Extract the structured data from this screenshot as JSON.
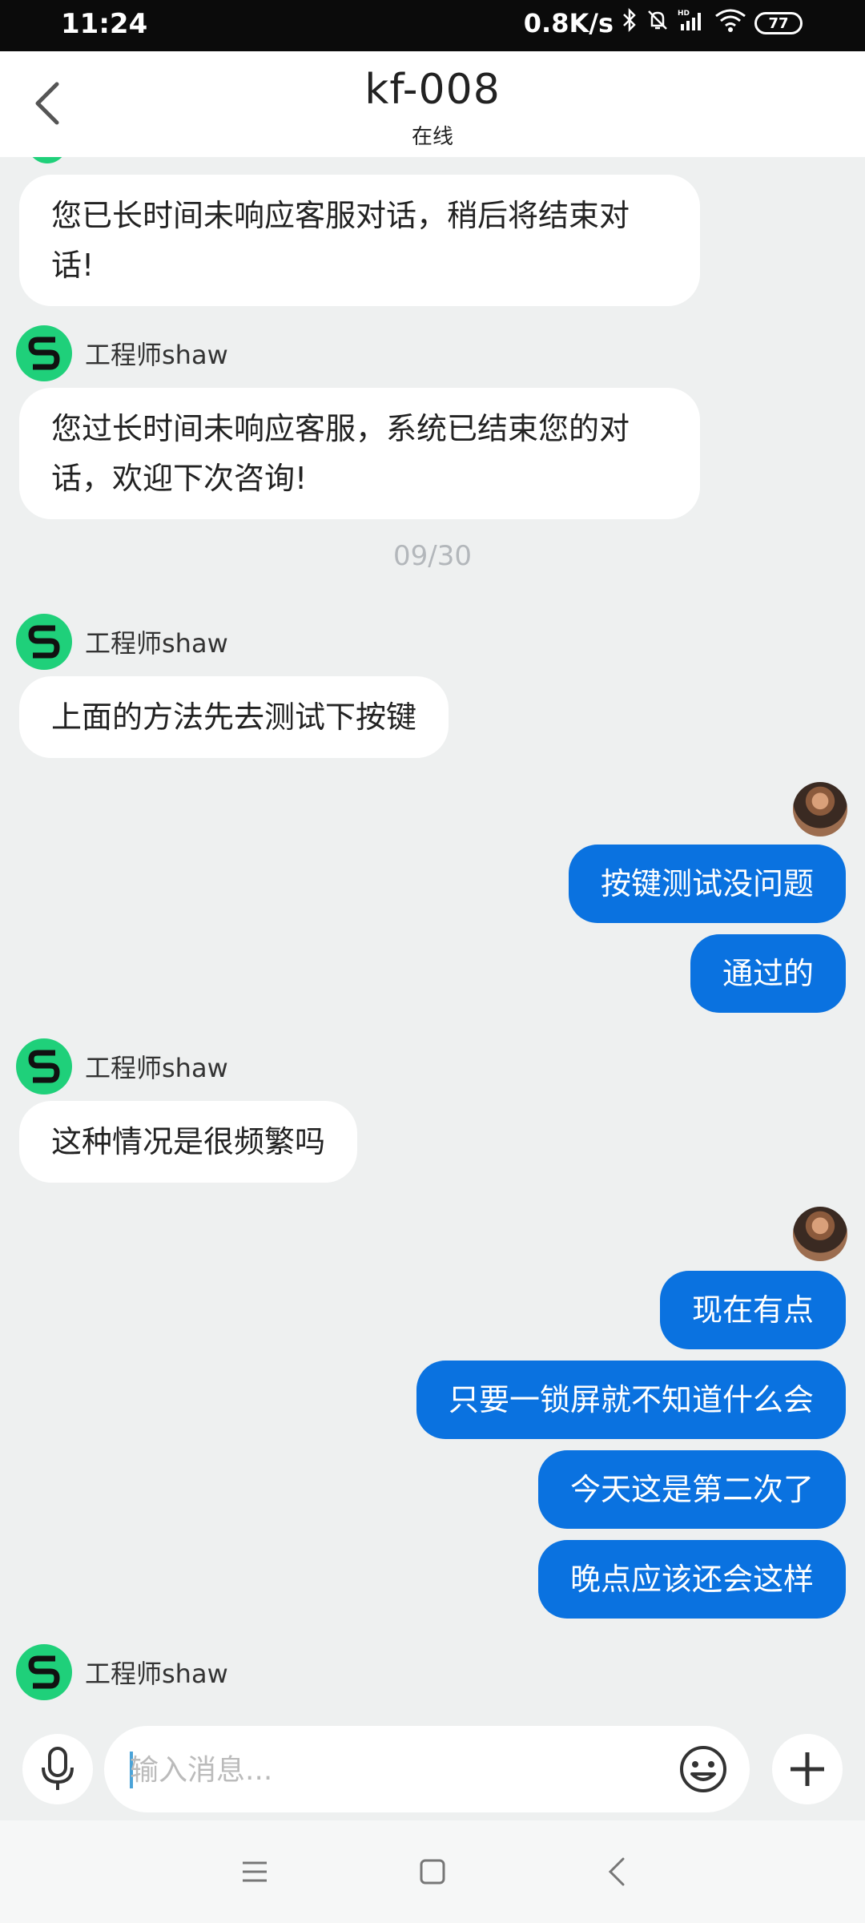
{
  "status_bar": {
    "time": "11:24",
    "speed": "0.8K/s",
    "battery": "77"
  },
  "header": {
    "title": "kf-008",
    "status": "在线"
  },
  "messages": [
    {
      "type": "in",
      "text_lines": [
        "您已长时间未响应客服对话，稍后将结束对",
        "话!"
      ]
    },
    {
      "type": "agent",
      "name": "工程师shaw"
    },
    {
      "type": "in",
      "text_lines": [
        "您过长时间未响应客服，系统已结束您的对",
        "话，欢迎下次咨询!"
      ]
    },
    {
      "type": "date",
      "text": "09/30"
    },
    {
      "type": "agent",
      "name": "工程师shaw"
    },
    {
      "type": "in",
      "text": "上面的方法先去测试下按键"
    },
    {
      "type": "out",
      "text": "按键测试没问题"
    },
    {
      "type": "out",
      "text": "通过的"
    },
    {
      "type": "agent",
      "name": "工程师shaw"
    },
    {
      "type": "in",
      "text": "这种情况是很频繁吗"
    },
    {
      "type": "out",
      "text": "现在有点"
    },
    {
      "type": "out",
      "text": "只要一锁屏就不知道什么会"
    },
    {
      "type": "out",
      "text": "今天这是第二次了"
    },
    {
      "type": "out",
      "text": "晚点应该还会这样"
    },
    {
      "type": "agent",
      "name": "工程师shaw"
    }
  ],
  "input": {
    "placeholder": "输入消息..."
  },
  "icons": {
    "back": "back-arrow-icon",
    "mic": "microphone-icon",
    "emoji": "emoji-icon",
    "plus": "plus-icon",
    "nav_menu": "menu-icon",
    "nav_home": "home-icon",
    "nav_back": "back-icon"
  },
  "colors": {
    "accent_blue": "#0a72e0",
    "agent_green": "#1fd07a",
    "background": "#eef0f0"
  }
}
